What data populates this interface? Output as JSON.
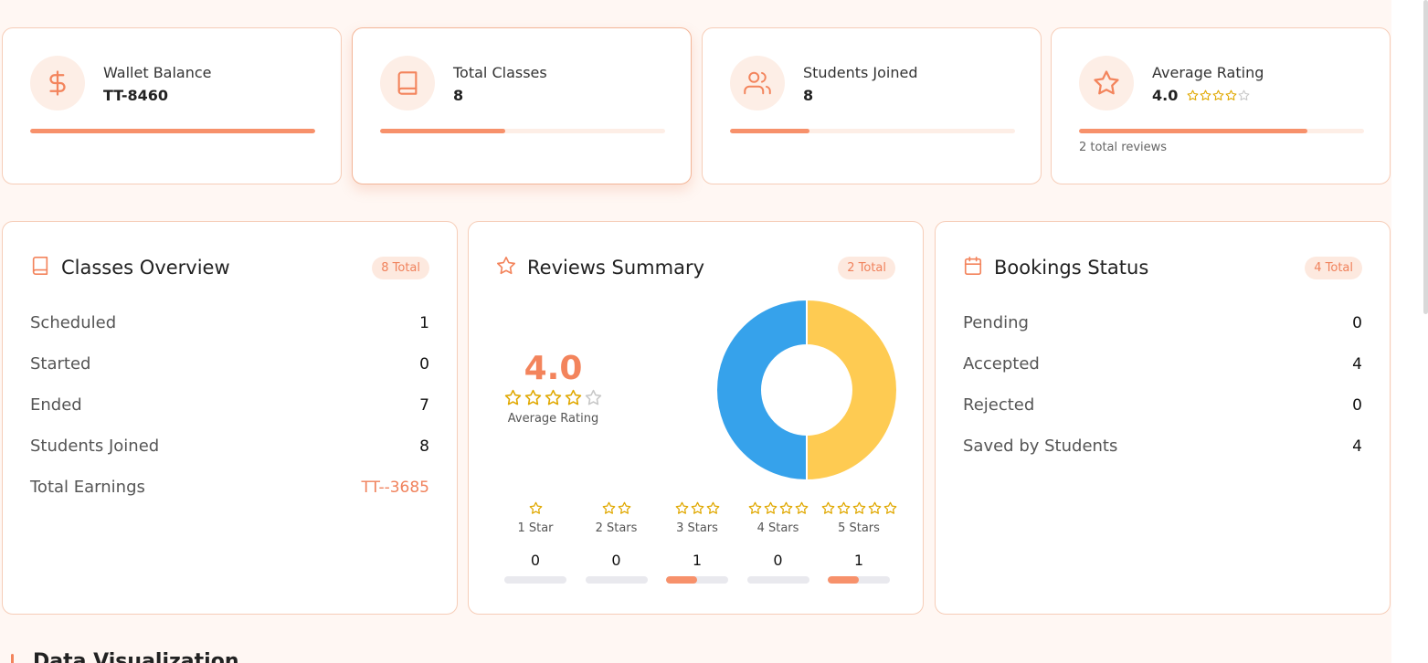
{
  "stats": [
    {
      "label": "Wallet Balance",
      "value": "TT-8460",
      "icon": "dollar-icon",
      "progress": 1.0
    },
    {
      "label": "Total Classes",
      "value": "8",
      "icon": "book-icon",
      "progress": 0.44
    },
    {
      "label": "Students Joined",
      "value": "8",
      "icon": "users-icon",
      "progress": 0.28
    },
    {
      "label": "Average Rating",
      "value": "4.0",
      "icon": "star-icon",
      "progress": 0.8,
      "stars_filled": 4,
      "stars_total": 5,
      "note": "2 total reviews"
    }
  ],
  "classes": {
    "title": "Classes Overview",
    "badge": "8 Total",
    "rows": [
      {
        "label": "Scheduled",
        "value": "1"
      },
      {
        "label": "Started",
        "value": "0"
      },
      {
        "label": "Ended",
        "value": "7"
      },
      {
        "label": "Students Joined",
        "value": "8"
      },
      {
        "label": "Total Earnings",
        "value": "TT--3685"
      }
    ]
  },
  "reviews": {
    "title": "Reviews Summary",
    "badge": "2 Total",
    "average": "4.0",
    "average_label": "Average Rating",
    "stars_filled": 4,
    "donut": [
      {
        "value": 1,
        "color": "#fecb52"
      },
      {
        "value": 1,
        "color": "#36a2eb"
      }
    ],
    "distribution": [
      {
        "label": "1 Star",
        "stars": 1,
        "count": "0",
        "fraction": 0
      },
      {
        "label": "2 Stars",
        "stars": 2,
        "count": "0",
        "fraction": 0
      },
      {
        "label": "3 Stars",
        "stars": 3,
        "count": "1",
        "fraction": 0.5
      },
      {
        "label": "4 Stars",
        "stars": 4,
        "count": "0",
        "fraction": 0
      },
      {
        "label": "5 Stars",
        "stars": 5,
        "count": "1",
        "fraction": 0.5
      }
    ]
  },
  "bookings": {
    "title": "Bookings Status",
    "badge": "4 Total",
    "rows": [
      {
        "label": "Pending",
        "value": "0"
      },
      {
        "label": "Accepted",
        "value": "4"
      },
      {
        "label": "Rejected",
        "value": "0"
      },
      {
        "label": "Saved by Students",
        "value": "4"
      }
    ]
  },
  "next_section": {
    "title": "Data Visualization"
  },
  "colors": {
    "accent": "#f3845c",
    "star": "#e0a800",
    "star_empty": "#c8c8c8"
  }
}
